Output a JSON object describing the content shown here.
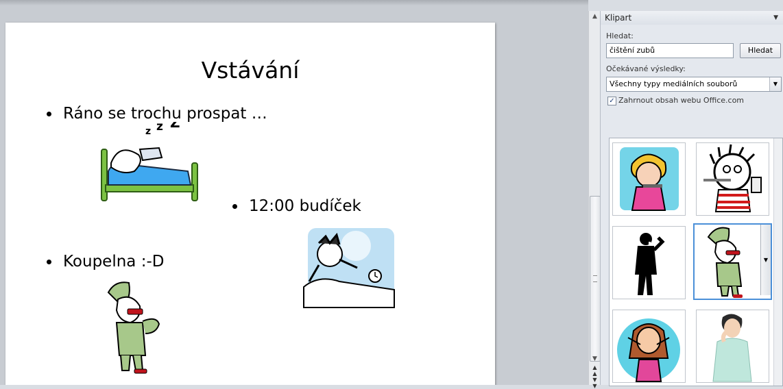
{
  "slide": {
    "title": "Vstávání",
    "bullets": [
      "Ráno se trochu prospat …",
      "12:00 budíček",
      "Koupelna  :-D"
    ]
  },
  "task_pane": {
    "title": "Klipart",
    "search_label": "Hledat:",
    "search_value": "čištění zubů",
    "search_button": "Hledat",
    "results_label": "Očekávané výsledky:",
    "results_select": "Všechny typy mediálních souborů",
    "include_office_label": "Zahrnout obsah webu Office.com",
    "include_office_checked": true
  },
  "icons": {
    "collapse": "triangle-up-icon",
    "dropdown": "triangle-down-icon"
  }
}
